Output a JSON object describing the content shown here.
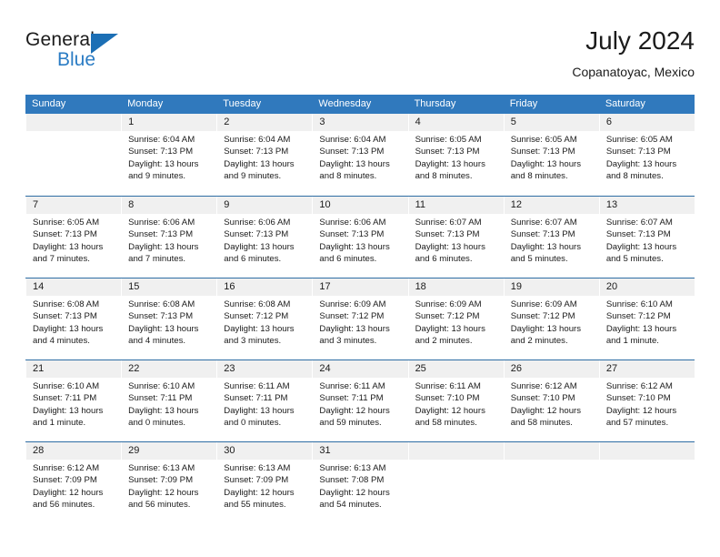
{
  "brand": {
    "name_top": "General",
    "name_bottom": "Blue"
  },
  "header": {
    "title": "July 2024",
    "subtitle": "Copanatoyac, Mexico"
  },
  "colors": {
    "header_blue": "#3079bd",
    "row_divider_blue": "#2e6da4",
    "daynum_band": "#f0f0f0",
    "brand_blue": "#2b7cc4"
  },
  "weekdays": [
    "Sunday",
    "Monday",
    "Tuesday",
    "Wednesday",
    "Thursday",
    "Friday",
    "Saturday"
  ],
  "weeks": [
    [
      {
        "empty": true,
        "day": "",
        "sunrise": "",
        "sunset": "",
        "daylight_line1": "",
        "daylight_line2": ""
      },
      {
        "empty": false,
        "day": "1",
        "sunrise": "Sunrise: 6:04 AM",
        "sunset": "Sunset: 7:13 PM",
        "daylight_line1": "Daylight: 13 hours",
        "daylight_line2": "and 9 minutes."
      },
      {
        "empty": false,
        "day": "2",
        "sunrise": "Sunrise: 6:04 AM",
        "sunset": "Sunset: 7:13 PM",
        "daylight_line1": "Daylight: 13 hours",
        "daylight_line2": "and 9 minutes."
      },
      {
        "empty": false,
        "day": "3",
        "sunrise": "Sunrise: 6:04 AM",
        "sunset": "Sunset: 7:13 PM",
        "daylight_line1": "Daylight: 13 hours",
        "daylight_line2": "and 8 minutes."
      },
      {
        "empty": false,
        "day": "4",
        "sunrise": "Sunrise: 6:05 AM",
        "sunset": "Sunset: 7:13 PM",
        "daylight_line1": "Daylight: 13 hours",
        "daylight_line2": "and 8 minutes."
      },
      {
        "empty": false,
        "day": "5",
        "sunrise": "Sunrise: 6:05 AM",
        "sunset": "Sunset: 7:13 PM",
        "daylight_line1": "Daylight: 13 hours",
        "daylight_line2": "and 8 minutes."
      },
      {
        "empty": false,
        "day": "6",
        "sunrise": "Sunrise: 6:05 AM",
        "sunset": "Sunset: 7:13 PM",
        "daylight_line1": "Daylight: 13 hours",
        "daylight_line2": "and 8 minutes."
      }
    ],
    [
      {
        "empty": false,
        "day": "7",
        "sunrise": "Sunrise: 6:05 AM",
        "sunset": "Sunset: 7:13 PM",
        "daylight_line1": "Daylight: 13 hours",
        "daylight_line2": "and 7 minutes."
      },
      {
        "empty": false,
        "day": "8",
        "sunrise": "Sunrise: 6:06 AM",
        "sunset": "Sunset: 7:13 PM",
        "daylight_line1": "Daylight: 13 hours",
        "daylight_line2": "and 7 minutes."
      },
      {
        "empty": false,
        "day": "9",
        "sunrise": "Sunrise: 6:06 AM",
        "sunset": "Sunset: 7:13 PM",
        "daylight_line1": "Daylight: 13 hours",
        "daylight_line2": "and 6 minutes."
      },
      {
        "empty": false,
        "day": "10",
        "sunrise": "Sunrise: 6:06 AM",
        "sunset": "Sunset: 7:13 PM",
        "daylight_line1": "Daylight: 13 hours",
        "daylight_line2": "and 6 minutes."
      },
      {
        "empty": false,
        "day": "11",
        "sunrise": "Sunrise: 6:07 AM",
        "sunset": "Sunset: 7:13 PM",
        "daylight_line1": "Daylight: 13 hours",
        "daylight_line2": "and 6 minutes."
      },
      {
        "empty": false,
        "day": "12",
        "sunrise": "Sunrise: 6:07 AM",
        "sunset": "Sunset: 7:13 PM",
        "daylight_line1": "Daylight: 13 hours",
        "daylight_line2": "and 5 minutes."
      },
      {
        "empty": false,
        "day": "13",
        "sunrise": "Sunrise: 6:07 AM",
        "sunset": "Sunset: 7:13 PM",
        "daylight_line1": "Daylight: 13 hours",
        "daylight_line2": "and 5 minutes."
      }
    ],
    [
      {
        "empty": false,
        "day": "14",
        "sunrise": "Sunrise: 6:08 AM",
        "sunset": "Sunset: 7:13 PM",
        "daylight_line1": "Daylight: 13 hours",
        "daylight_line2": "and 4 minutes."
      },
      {
        "empty": false,
        "day": "15",
        "sunrise": "Sunrise: 6:08 AM",
        "sunset": "Sunset: 7:13 PM",
        "daylight_line1": "Daylight: 13 hours",
        "daylight_line2": "and 4 minutes."
      },
      {
        "empty": false,
        "day": "16",
        "sunrise": "Sunrise: 6:08 AM",
        "sunset": "Sunset: 7:12 PM",
        "daylight_line1": "Daylight: 13 hours",
        "daylight_line2": "and 3 minutes."
      },
      {
        "empty": false,
        "day": "17",
        "sunrise": "Sunrise: 6:09 AM",
        "sunset": "Sunset: 7:12 PM",
        "daylight_line1": "Daylight: 13 hours",
        "daylight_line2": "and 3 minutes."
      },
      {
        "empty": false,
        "day": "18",
        "sunrise": "Sunrise: 6:09 AM",
        "sunset": "Sunset: 7:12 PM",
        "daylight_line1": "Daylight: 13 hours",
        "daylight_line2": "and 2 minutes."
      },
      {
        "empty": false,
        "day": "19",
        "sunrise": "Sunrise: 6:09 AM",
        "sunset": "Sunset: 7:12 PM",
        "daylight_line1": "Daylight: 13 hours",
        "daylight_line2": "and 2 minutes."
      },
      {
        "empty": false,
        "day": "20",
        "sunrise": "Sunrise: 6:10 AM",
        "sunset": "Sunset: 7:12 PM",
        "daylight_line1": "Daylight: 13 hours",
        "daylight_line2": "and 1 minute."
      }
    ],
    [
      {
        "empty": false,
        "day": "21",
        "sunrise": "Sunrise: 6:10 AM",
        "sunset": "Sunset: 7:11 PM",
        "daylight_line1": "Daylight: 13 hours",
        "daylight_line2": "and 1 minute."
      },
      {
        "empty": false,
        "day": "22",
        "sunrise": "Sunrise: 6:10 AM",
        "sunset": "Sunset: 7:11 PM",
        "daylight_line1": "Daylight: 13 hours",
        "daylight_line2": "and 0 minutes."
      },
      {
        "empty": false,
        "day": "23",
        "sunrise": "Sunrise: 6:11 AM",
        "sunset": "Sunset: 7:11 PM",
        "daylight_line1": "Daylight: 13 hours",
        "daylight_line2": "and 0 minutes."
      },
      {
        "empty": false,
        "day": "24",
        "sunrise": "Sunrise: 6:11 AM",
        "sunset": "Sunset: 7:11 PM",
        "daylight_line1": "Daylight: 12 hours",
        "daylight_line2": "and 59 minutes."
      },
      {
        "empty": false,
        "day": "25",
        "sunrise": "Sunrise: 6:11 AM",
        "sunset": "Sunset: 7:10 PM",
        "daylight_line1": "Daylight: 12 hours",
        "daylight_line2": "and 58 minutes."
      },
      {
        "empty": false,
        "day": "26",
        "sunrise": "Sunrise: 6:12 AM",
        "sunset": "Sunset: 7:10 PM",
        "daylight_line1": "Daylight: 12 hours",
        "daylight_line2": "and 58 minutes."
      },
      {
        "empty": false,
        "day": "27",
        "sunrise": "Sunrise: 6:12 AM",
        "sunset": "Sunset: 7:10 PM",
        "daylight_line1": "Daylight: 12 hours",
        "daylight_line2": "and 57 minutes."
      }
    ],
    [
      {
        "empty": false,
        "day": "28",
        "sunrise": "Sunrise: 6:12 AM",
        "sunset": "Sunset: 7:09 PM",
        "daylight_line1": "Daylight: 12 hours",
        "daylight_line2": "and 56 minutes."
      },
      {
        "empty": false,
        "day": "29",
        "sunrise": "Sunrise: 6:13 AM",
        "sunset": "Sunset: 7:09 PM",
        "daylight_line1": "Daylight: 12 hours",
        "daylight_line2": "and 56 minutes."
      },
      {
        "empty": false,
        "day": "30",
        "sunrise": "Sunrise: 6:13 AM",
        "sunset": "Sunset: 7:09 PM",
        "daylight_line1": "Daylight: 12 hours",
        "daylight_line2": "and 55 minutes."
      },
      {
        "empty": false,
        "day": "31",
        "sunrise": "Sunrise: 6:13 AM",
        "sunset": "Sunset: 7:08 PM",
        "daylight_line1": "Daylight: 12 hours",
        "daylight_line2": "and 54 minutes."
      },
      {
        "empty": true,
        "day": "",
        "sunrise": "",
        "sunset": "",
        "daylight_line1": "",
        "daylight_line2": ""
      },
      {
        "empty": true,
        "day": "",
        "sunrise": "",
        "sunset": "",
        "daylight_line1": "",
        "daylight_line2": ""
      },
      {
        "empty": true,
        "day": "",
        "sunrise": "",
        "sunset": "",
        "daylight_line1": "",
        "daylight_line2": ""
      }
    ]
  ]
}
